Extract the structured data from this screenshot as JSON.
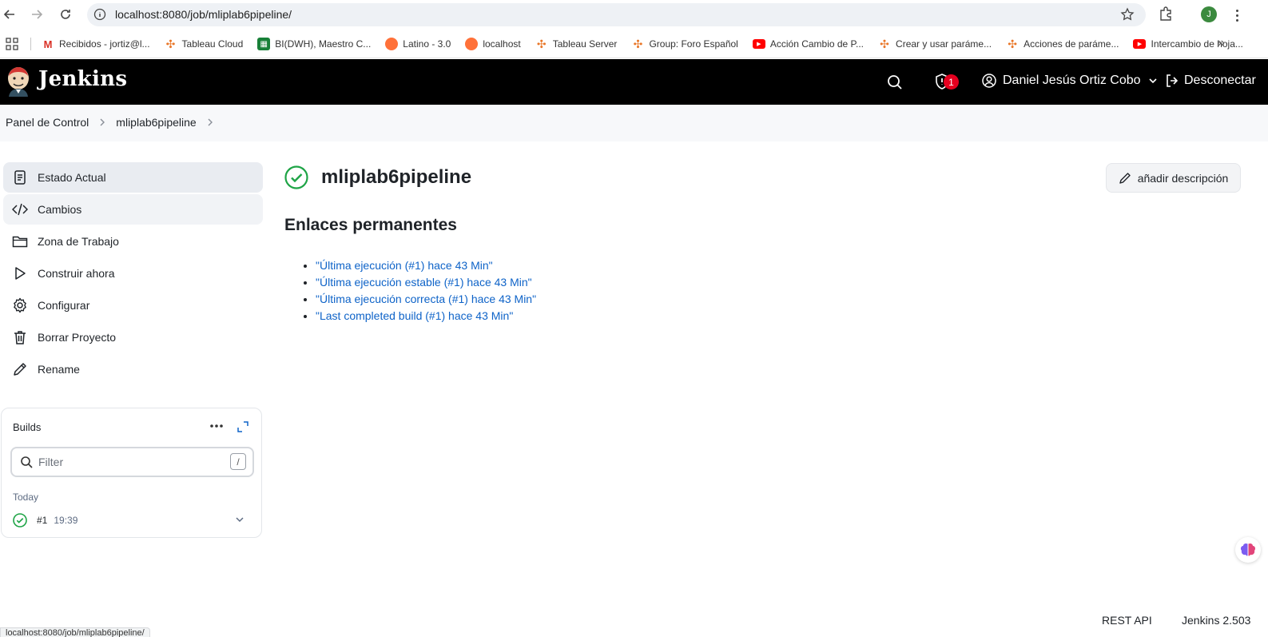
{
  "browser": {
    "url": "localhost:8080/job/mliplab6pipeline/",
    "profile_initial": "J",
    "bookmarks": [
      {
        "label": "Recibidos - jortiz@l...",
        "icon": "gmail-icon",
        "color": "#d93025"
      },
      {
        "label": "Tableau Cloud",
        "icon": "tableau-icon",
        "color": "#e97627"
      },
      {
        "label": "BI(DWH), Maestro C...",
        "icon": "sheets-icon",
        "color": "#188038"
      },
      {
        "label": "Latino - 3.0",
        "icon": "firefox-icon",
        "color": "#ff7139"
      },
      {
        "label": "localhost",
        "icon": "firefox-icon",
        "color": "#ff7139"
      },
      {
        "label": "Tableau Server",
        "icon": "tableau-icon",
        "color": "#e97627"
      },
      {
        "label": "Group: Foro Español",
        "icon": "tableau-icon",
        "color": "#e97627"
      },
      {
        "label": "Acción Cambio de P...",
        "icon": "youtube-icon",
        "color": "#ff0000"
      },
      {
        "label": "Crear y usar paráme...",
        "icon": "tableau-icon",
        "color": "#e97627"
      },
      {
        "label": "Acciones de paráme...",
        "icon": "tableau-icon",
        "color": "#e97627"
      },
      {
        "label": "Intercambio de hoja...",
        "icon": "youtube-icon",
        "color": "#ff0000"
      }
    ],
    "status_url": "localhost:8080/job/mliplab6pipeline/"
  },
  "header": {
    "title": "Jenkins",
    "security_count": "1",
    "user_name": "Daniel Jesús Ortiz Cobo",
    "logout_label": "Desconectar"
  },
  "breadcrumb": {
    "items": [
      "Panel de Control",
      "mliplab6pipeline"
    ]
  },
  "sidebar": {
    "items": [
      {
        "label": "Estado Actual",
        "icon": "status-icon"
      },
      {
        "label": "Cambios",
        "icon": "code-icon"
      },
      {
        "label": "Zona de Trabajo",
        "icon": "folder-icon"
      },
      {
        "label": "Construir ahora",
        "icon": "play-icon"
      },
      {
        "label": "Configurar",
        "icon": "gear-icon"
      },
      {
        "label": "Borrar Proyecto",
        "icon": "trash-icon"
      },
      {
        "label": "Rename",
        "icon": "pencil-icon"
      }
    ]
  },
  "builds": {
    "title": "Builds",
    "filter_placeholder": "Filter",
    "shortcut": "/",
    "group_label": "Today",
    "rows": [
      {
        "number": "#1",
        "time": "19:39",
        "status": "success"
      }
    ]
  },
  "main": {
    "job_name": "mliplab6pipeline",
    "add_description_label": "añadir descripción",
    "permalinks_title": "Enlaces permanentes",
    "permalinks": [
      "\"Última ejecución (#1) hace 43 Min\"",
      "\"Última ejecución estable (#1) hace 43 Min\"",
      "\"Última ejecución correcta (#1) hace 43 Min\"",
      "\"Last completed build (#1) hace 43 Min\""
    ]
  },
  "footer": {
    "rest_api": "REST API",
    "version": "Jenkins 2.503"
  },
  "colors": {
    "success": "#1ea446",
    "link": "#0e63c8",
    "header_bg": "#000000",
    "badge": "#e6001f"
  }
}
